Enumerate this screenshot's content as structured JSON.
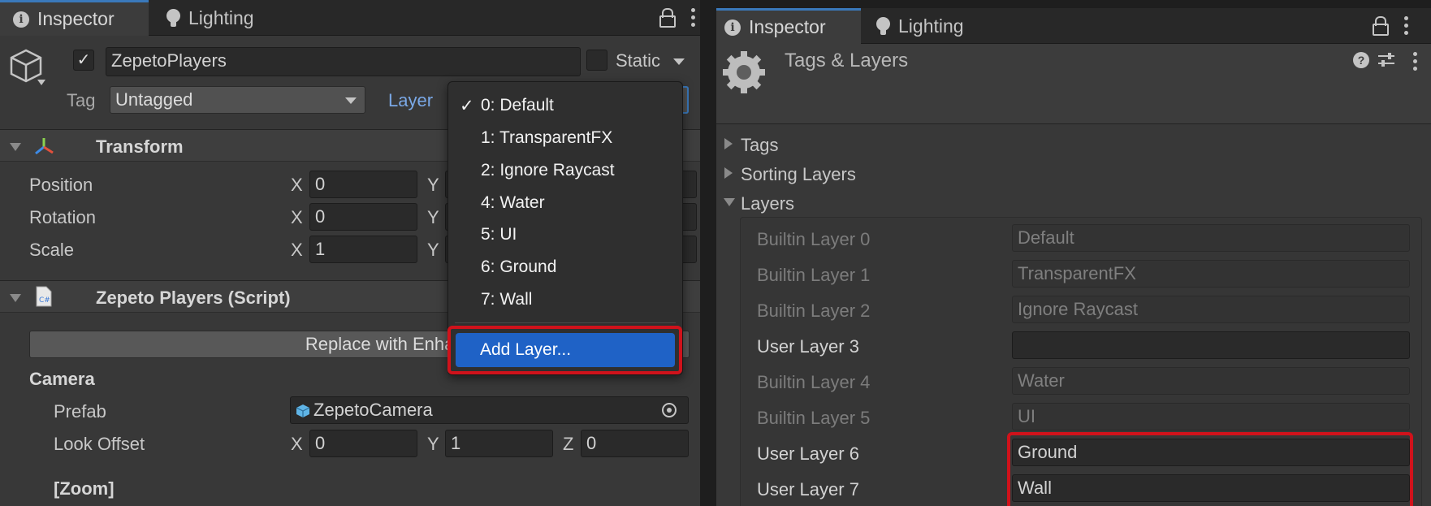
{
  "left_panel": {
    "tabs": [
      {
        "label": "Inspector",
        "icon": "info-icon",
        "active": true
      },
      {
        "label": "Lighting",
        "icon": "lightbulb-icon",
        "active": false
      }
    ],
    "object": {
      "name": "ZepetoPlayers",
      "active_checked": true,
      "static_label": "Static",
      "tag_label": "Tag",
      "tag_value": "Untagged",
      "layer_label": "Layer"
    },
    "transform": {
      "title": "Transform",
      "rows": [
        {
          "label": "Position",
          "x": "0"
        },
        {
          "label": "Rotation",
          "x": "0"
        },
        {
          "label": "Scale",
          "x": "1"
        }
      ],
      "axis_x": "X",
      "axis_y": "Y"
    },
    "script": {
      "title": "Zepeto Players (Script)",
      "replace_button": "Replace with Enhanced C",
      "camera_header": "Camera",
      "prefab_label": "Prefab",
      "prefab_value": "ZepetoCamera",
      "look_offset_label": "Look Offset",
      "look_offset": {
        "x": "0",
        "y": "1",
        "z": "0"
      },
      "axis_z": "Z",
      "zoom_header": "[Zoom]"
    },
    "layer_menu": {
      "items": [
        {
          "label": "0: Default",
          "checked": true
        },
        {
          "label": "1: TransparentFX",
          "checked": false
        },
        {
          "label": "2: Ignore Raycast",
          "checked": false
        },
        {
          "label": "4: Water",
          "checked": false
        },
        {
          "label": "5: UI",
          "checked": false
        },
        {
          "label": "6: Ground",
          "checked": false
        },
        {
          "label": "7: Wall",
          "checked": false
        }
      ],
      "check_glyph": "✓",
      "add_layer": "Add Layer..."
    }
  },
  "right_panel": {
    "tabs": [
      {
        "label": "Inspector",
        "icon": "info-icon",
        "active": true
      },
      {
        "label": "Lighting",
        "icon": "lightbulb-icon",
        "active": false
      }
    ],
    "title": "Tags & Layers",
    "sections": {
      "tags": "Tags",
      "sorting_layers": "Sorting Layers",
      "layers": "Layers"
    },
    "layers": [
      {
        "label": "Builtin Layer 0",
        "value": "Default",
        "editable": false
      },
      {
        "label": "Builtin Layer 1",
        "value": "TransparentFX",
        "editable": false
      },
      {
        "label": "Builtin Layer 2",
        "value": "Ignore Raycast",
        "editable": false
      },
      {
        "label": "User Layer 3",
        "value": "",
        "editable": true
      },
      {
        "label": "Builtin Layer 4",
        "value": "Water",
        "editable": false
      },
      {
        "label": "Builtin Layer 5",
        "value": "UI",
        "editable": false
      },
      {
        "label": "User Layer 6",
        "value": "Ground",
        "editable": true
      },
      {
        "label": "User Layer 7",
        "value": "Wall",
        "editable": true
      }
    ]
  },
  "colors": {
    "highlight_red": "#d0121b",
    "selection_blue": "#1f62c6",
    "tab_accent": "#3a79bb",
    "panel_bg": "#383838"
  }
}
